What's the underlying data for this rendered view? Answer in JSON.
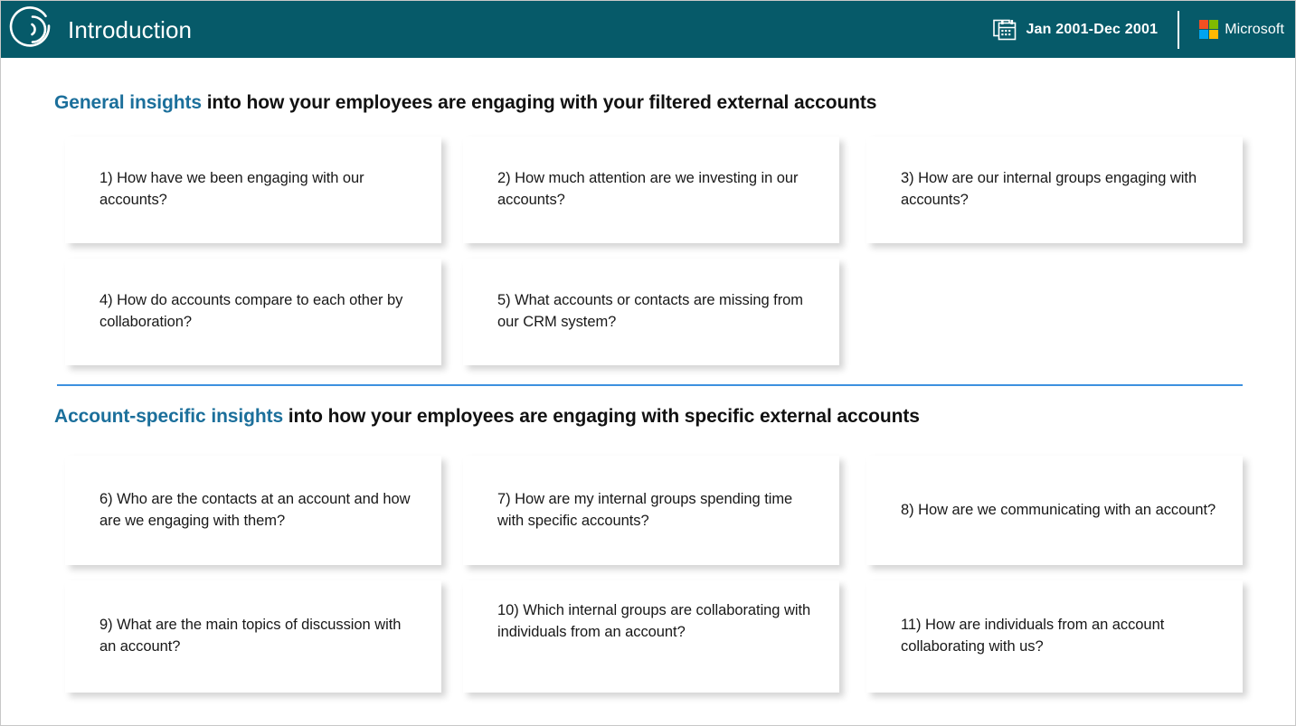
{
  "header": {
    "logo_icon": "viva-insights-sonar-icon",
    "title": "Introduction",
    "calendar_icon": "calendar-icon",
    "date_range": "Jan 2001-Dec 2001",
    "brand_name": "Microsoft",
    "brand_colors": {
      "top_left": "#F25022",
      "top_right": "#7FBA00",
      "bottom_left": "#00A4EF",
      "bottom_right": "#FFB900"
    },
    "background_color": "#065A69"
  },
  "theme": {
    "accent_teal": "#065A69",
    "heading_blue": "#1B6F9B",
    "rule_blue": "#3D91DF",
    "card_background": "#FFFFFF",
    "page_background": "#FFFFFF"
  },
  "sections": [
    {
      "heading_highlight": "General insights",
      "heading_rest": " into how your employees are engaging with your filtered external accounts",
      "cards": [
        {
          "label": "1) How have we been engaging with our accounts?"
        },
        {
          "label": "2) How much attention are we investing in our accounts?"
        },
        {
          "label": "3) How are our internal groups engaging with accounts?"
        },
        {
          "label": "4) How do accounts compare to each other by collaboration?"
        },
        {
          "label": "5) What accounts or contacts are missing from our CRM system?"
        }
      ]
    },
    {
      "heading_highlight": "Account-specific insights",
      "heading_rest": " into how your employees are engaging with specific external accounts",
      "cards": [
        {
          "label": "6) Who are the contacts at an account and how are we engaging with them?"
        },
        {
          "label": "7) How are my internal groups spending time with specific accounts?"
        },
        {
          "label": "8) How are we communicating with an account?"
        },
        {
          "label": "9) What are the main topics of discussion with an account?"
        },
        {
          "label": "10) Which internal groups are collaborating with individuals from an account?"
        },
        {
          "label": "11) How are individuals from an account collaborating with us?"
        }
      ]
    }
  ]
}
